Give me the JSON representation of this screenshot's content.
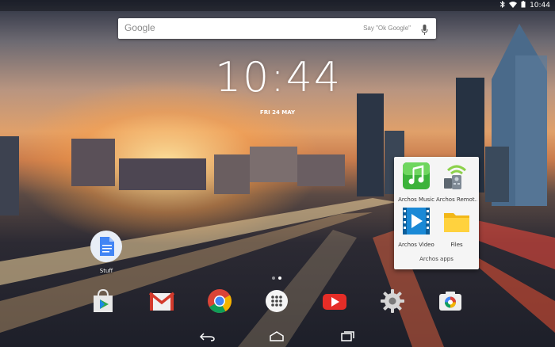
{
  "status": {
    "time": "10:44"
  },
  "search": {
    "logo": "Google",
    "hint": "Say \"Ok Google\""
  },
  "clock": {
    "time": "10:44",
    "date": "FRI 24 MAY"
  },
  "shortcut": {
    "label": "Stuff"
  },
  "folder": {
    "name": "Archos apps",
    "apps": [
      {
        "label": "Archos Music"
      },
      {
        "label": "Archos Remot..."
      },
      {
        "label": "Archos Video"
      },
      {
        "label": "Files"
      }
    ]
  },
  "dock": {
    "apps": [
      "play-store-icon",
      "gmail-icon",
      "chrome-icon",
      "app-drawer-icon",
      "youtube-icon",
      "settings-icon",
      "camera-icon"
    ]
  },
  "colors": {
    "accent": "#4285f4",
    "folder_bg": "#f5f5f5"
  }
}
